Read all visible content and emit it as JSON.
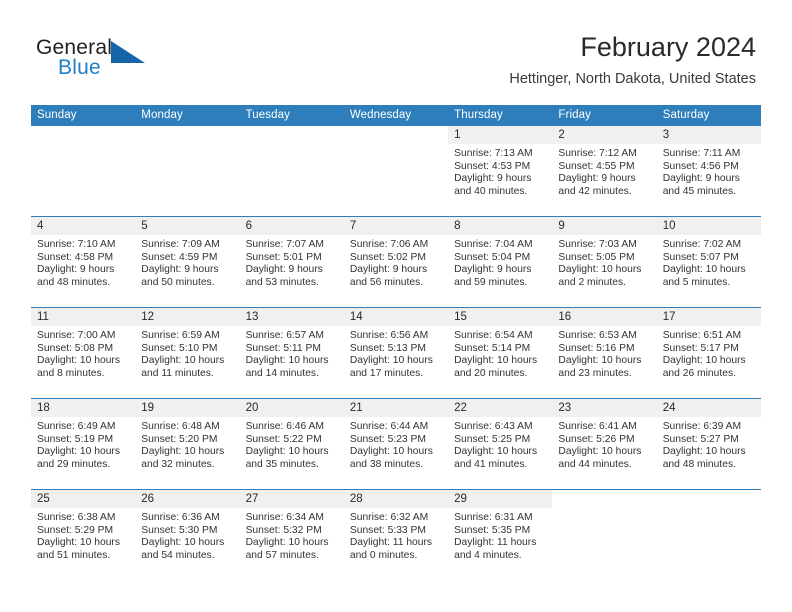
{
  "brand": {
    "name_part1": "General",
    "name_part2": "Blue",
    "accent_color": "#1565a8",
    "text_color": "#231f20"
  },
  "header": {
    "title": "February 2024",
    "subtitle": "Hettinger, North Dakota, United States"
  },
  "theme": {
    "header_blue": "#2e7ebc",
    "row_strip_gray": "#f0f0f0",
    "body_text": "#333333"
  },
  "calendar": {
    "weekday_headers": [
      "Sunday",
      "Monday",
      "Tuesday",
      "Wednesday",
      "Thursday",
      "Friday",
      "Saturday"
    ],
    "weeks": [
      [
        {
          "day": "",
          "sunrise": "",
          "sunset": "",
          "daylight_1": "",
          "daylight_2": "",
          "empty": true,
          "blank": true
        },
        {
          "day": "",
          "sunrise": "",
          "sunset": "",
          "daylight_1": "",
          "daylight_2": "",
          "empty": true,
          "blank": true
        },
        {
          "day": "",
          "sunrise": "",
          "sunset": "",
          "daylight_1": "",
          "daylight_2": "",
          "empty": true,
          "blank": true
        },
        {
          "day": "",
          "sunrise": "",
          "sunset": "",
          "daylight_1": "",
          "daylight_2": "",
          "empty": true,
          "blank": true
        },
        {
          "day": "1",
          "sunrise": "Sunrise: 7:13 AM",
          "sunset": "Sunset: 4:53 PM",
          "daylight_1": "Daylight: 9 hours",
          "daylight_2": "and 40 minutes."
        },
        {
          "day": "2",
          "sunrise": "Sunrise: 7:12 AM",
          "sunset": "Sunset: 4:55 PM",
          "daylight_1": "Daylight: 9 hours",
          "daylight_2": "and 42 minutes."
        },
        {
          "day": "3",
          "sunrise": "Sunrise: 7:11 AM",
          "sunset": "Sunset: 4:56 PM",
          "daylight_1": "Daylight: 9 hours",
          "daylight_2": "and 45 minutes."
        }
      ],
      [
        {
          "day": "4",
          "sunrise": "Sunrise: 7:10 AM",
          "sunset": "Sunset: 4:58 PM",
          "daylight_1": "Daylight: 9 hours",
          "daylight_2": "and 48 minutes."
        },
        {
          "day": "5",
          "sunrise": "Sunrise: 7:09 AM",
          "sunset": "Sunset: 4:59 PM",
          "daylight_1": "Daylight: 9 hours",
          "daylight_2": "and 50 minutes."
        },
        {
          "day": "6",
          "sunrise": "Sunrise: 7:07 AM",
          "sunset": "Sunset: 5:01 PM",
          "daylight_1": "Daylight: 9 hours",
          "daylight_2": "and 53 minutes."
        },
        {
          "day": "7",
          "sunrise": "Sunrise: 7:06 AM",
          "sunset": "Sunset: 5:02 PM",
          "daylight_1": "Daylight: 9 hours",
          "daylight_2": "and 56 minutes."
        },
        {
          "day": "8",
          "sunrise": "Sunrise: 7:04 AM",
          "sunset": "Sunset: 5:04 PM",
          "daylight_1": "Daylight: 9 hours",
          "daylight_2": "and 59 minutes."
        },
        {
          "day": "9",
          "sunrise": "Sunrise: 7:03 AM",
          "sunset": "Sunset: 5:05 PM",
          "daylight_1": "Daylight: 10 hours",
          "daylight_2": "and 2 minutes."
        },
        {
          "day": "10",
          "sunrise": "Sunrise: 7:02 AM",
          "sunset": "Sunset: 5:07 PM",
          "daylight_1": "Daylight: 10 hours",
          "daylight_2": "and 5 minutes."
        }
      ],
      [
        {
          "day": "11",
          "sunrise": "Sunrise: 7:00 AM",
          "sunset": "Sunset: 5:08 PM",
          "daylight_1": "Daylight: 10 hours",
          "daylight_2": "and 8 minutes."
        },
        {
          "day": "12",
          "sunrise": "Sunrise: 6:59 AM",
          "sunset": "Sunset: 5:10 PM",
          "daylight_1": "Daylight: 10 hours",
          "daylight_2": "and 11 minutes."
        },
        {
          "day": "13",
          "sunrise": "Sunrise: 6:57 AM",
          "sunset": "Sunset: 5:11 PM",
          "daylight_1": "Daylight: 10 hours",
          "daylight_2": "and 14 minutes."
        },
        {
          "day": "14",
          "sunrise": "Sunrise: 6:56 AM",
          "sunset": "Sunset: 5:13 PM",
          "daylight_1": "Daylight: 10 hours",
          "daylight_2": "and 17 minutes."
        },
        {
          "day": "15",
          "sunrise": "Sunrise: 6:54 AM",
          "sunset": "Sunset: 5:14 PM",
          "daylight_1": "Daylight: 10 hours",
          "daylight_2": "and 20 minutes."
        },
        {
          "day": "16",
          "sunrise": "Sunrise: 6:53 AM",
          "sunset": "Sunset: 5:16 PM",
          "daylight_1": "Daylight: 10 hours",
          "daylight_2": "and 23 minutes."
        },
        {
          "day": "17",
          "sunrise": "Sunrise: 6:51 AM",
          "sunset": "Sunset: 5:17 PM",
          "daylight_1": "Daylight: 10 hours",
          "daylight_2": "and 26 minutes."
        }
      ],
      [
        {
          "day": "18",
          "sunrise": "Sunrise: 6:49 AM",
          "sunset": "Sunset: 5:19 PM",
          "daylight_1": "Daylight: 10 hours",
          "daylight_2": "and 29 minutes."
        },
        {
          "day": "19",
          "sunrise": "Sunrise: 6:48 AM",
          "sunset": "Sunset: 5:20 PM",
          "daylight_1": "Daylight: 10 hours",
          "daylight_2": "and 32 minutes."
        },
        {
          "day": "20",
          "sunrise": "Sunrise: 6:46 AM",
          "sunset": "Sunset: 5:22 PM",
          "daylight_1": "Daylight: 10 hours",
          "daylight_2": "and 35 minutes."
        },
        {
          "day": "21",
          "sunrise": "Sunrise: 6:44 AM",
          "sunset": "Sunset: 5:23 PM",
          "daylight_1": "Daylight: 10 hours",
          "daylight_2": "and 38 minutes."
        },
        {
          "day": "22",
          "sunrise": "Sunrise: 6:43 AM",
          "sunset": "Sunset: 5:25 PM",
          "daylight_1": "Daylight: 10 hours",
          "daylight_2": "and 41 minutes."
        },
        {
          "day": "23",
          "sunrise": "Sunrise: 6:41 AM",
          "sunset": "Sunset: 5:26 PM",
          "daylight_1": "Daylight: 10 hours",
          "daylight_2": "and 44 minutes."
        },
        {
          "day": "24",
          "sunrise": "Sunrise: 6:39 AM",
          "sunset": "Sunset: 5:27 PM",
          "daylight_1": "Daylight: 10 hours",
          "daylight_2": "and 48 minutes."
        }
      ],
      [
        {
          "day": "25",
          "sunrise": "Sunrise: 6:38 AM",
          "sunset": "Sunset: 5:29 PM",
          "daylight_1": "Daylight: 10 hours",
          "daylight_2": "and 51 minutes."
        },
        {
          "day": "26",
          "sunrise": "Sunrise: 6:36 AM",
          "sunset": "Sunset: 5:30 PM",
          "daylight_1": "Daylight: 10 hours",
          "daylight_2": "and 54 minutes."
        },
        {
          "day": "27",
          "sunrise": "Sunrise: 6:34 AM",
          "sunset": "Sunset: 5:32 PM",
          "daylight_1": "Daylight: 10 hours",
          "daylight_2": "and 57 minutes."
        },
        {
          "day": "28",
          "sunrise": "Sunrise: 6:32 AM",
          "sunset": "Sunset: 5:33 PM",
          "daylight_1": "Daylight: 11 hours",
          "daylight_2": "and 0 minutes."
        },
        {
          "day": "29",
          "sunrise": "Sunrise: 6:31 AM",
          "sunset": "Sunset: 5:35 PM",
          "daylight_1": "Daylight: 11 hours",
          "daylight_2": "and 4 minutes."
        },
        {
          "day": "",
          "sunrise": "",
          "sunset": "",
          "daylight_1": "",
          "daylight_2": "",
          "empty": true,
          "blank": true
        },
        {
          "day": "",
          "sunrise": "",
          "sunset": "",
          "daylight_1": "",
          "daylight_2": "",
          "empty": true,
          "blank": true
        }
      ]
    ]
  }
}
